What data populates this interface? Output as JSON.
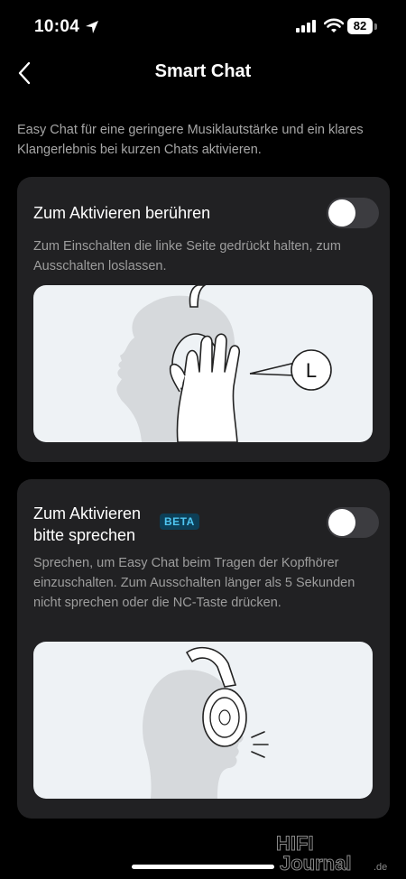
{
  "status": {
    "time": "10:04",
    "battery": "82"
  },
  "nav": {
    "title": "Smart Chat"
  },
  "intro": "Easy Chat für eine geringere Musiklautstärke und ein klares Klangerlebnis bei kurzen Chats aktivieren.",
  "touch": {
    "title": "Zum Aktivieren berühren",
    "description": "Zum Einschalten die linke Seite gedrückt halten, zum Ausschalten loslassen.",
    "toggle_on": false,
    "bubble_label": "L"
  },
  "speak": {
    "title": "Zum Aktivieren bitte sprechen",
    "badge": "BETA",
    "description": "Sprechen, um Easy Chat beim Tragen der Kopfhörer einzuschalten. Zum Ausschalten länger als 5 Sekunden nicht sprechen oder die NC-Taste drücken.",
    "toggle_on": false
  },
  "watermark": {
    "line1": "HIFI",
    "line2": "Journal",
    "suffix": ".de"
  }
}
